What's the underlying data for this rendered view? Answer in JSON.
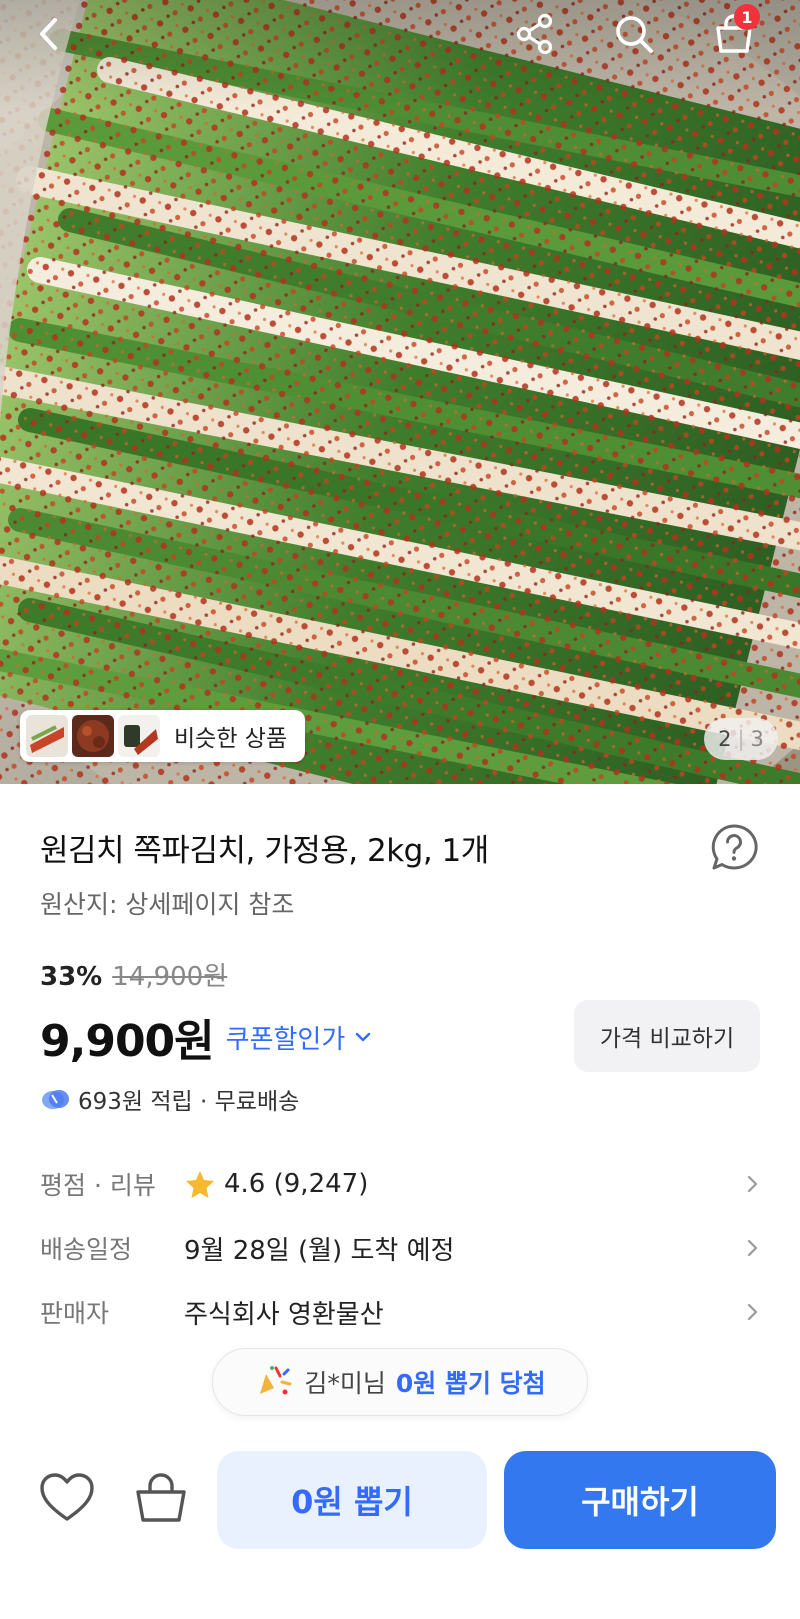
{
  "header": {
    "back_icon": "chevron-left-icon",
    "share_icon": "share-icon",
    "search_icon": "search-icon",
    "cart_icon": "shopping-bag-icon",
    "cart_count": "1"
  },
  "gallery": {
    "similar_label": "비슷한 상품",
    "current_page": "2",
    "total_pages": "3"
  },
  "product": {
    "title": "원김치 쪽파김치, 가정용, 2kg, 1개",
    "origin": "원산지: 상세페이지 참조",
    "discount_rate": "33%",
    "original_price": "14,900원",
    "price": "9,900원",
    "coupon_label": "쿠폰할인가",
    "compare_label": "가격 비교하기",
    "reward_text": "693원 적립 · 무료배송"
  },
  "details": {
    "rating_label": "평점 · 리뷰",
    "rating_value": "4.6 (9,247)",
    "delivery_label": "배송일정",
    "delivery_value": "9월 28일 (월) 도착 예정",
    "seller_label": "판매자",
    "seller_value": "주식회사 영환물산"
  },
  "winner_banner": {
    "name": "김*미님",
    "highlight": "0원 뽑기 당첨"
  },
  "bottom": {
    "wishlist_icon": "heart-icon",
    "cart_icon": "basket-icon",
    "draw_label": "0원 뽑기",
    "buy_label": "구매하기"
  },
  "colors": {
    "accent": "#346aff",
    "buy_button": "#3478f0",
    "draw_button_bg": "#eaf1fe",
    "badge": "#f0323c",
    "star": "#f5b82e"
  }
}
